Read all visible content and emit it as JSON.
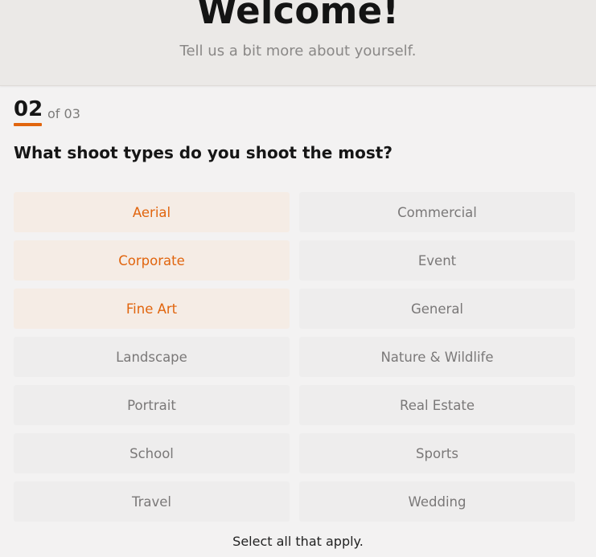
{
  "header": {
    "title": "Welcome!",
    "subtitle": "Tell us a bit more about yourself."
  },
  "step": {
    "current": "02",
    "total_label": "of 03"
  },
  "question": "What shoot types do you shoot the most?",
  "accent_color": "#e1650e",
  "options": [
    {
      "label": "Aerial",
      "selected": true
    },
    {
      "label": "Commercial",
      "selected": false
    },
    {
      "label": "Corporate",
      "selected": true
    },
    {
      "label": "Event",
      "selected": false
    },
    {
      "label": "Fine Art",
      "selected": true
    },
    {
      "label": "General",
      "selected": false
    },
    {
      "label": "Landscape",
      "selected": false
    },
    {
      "label": "Nature & Wildlife",
      "selected": false
    },
    {
      "label": "Portrait",
      "selected": false
    },
    {
      "label": "Real Estate",
      "selected": false
    },
    {
      "label": "School",
      "selected": false
    },
    {
      "label": "Sports",
      "selected": false
    },
    {
      "label": "Travel",
      "selected": false
    },
    {
      "label": "Wedding",
      "selected": false
    }
  ],
  "footer": "Select all that apply."
}
